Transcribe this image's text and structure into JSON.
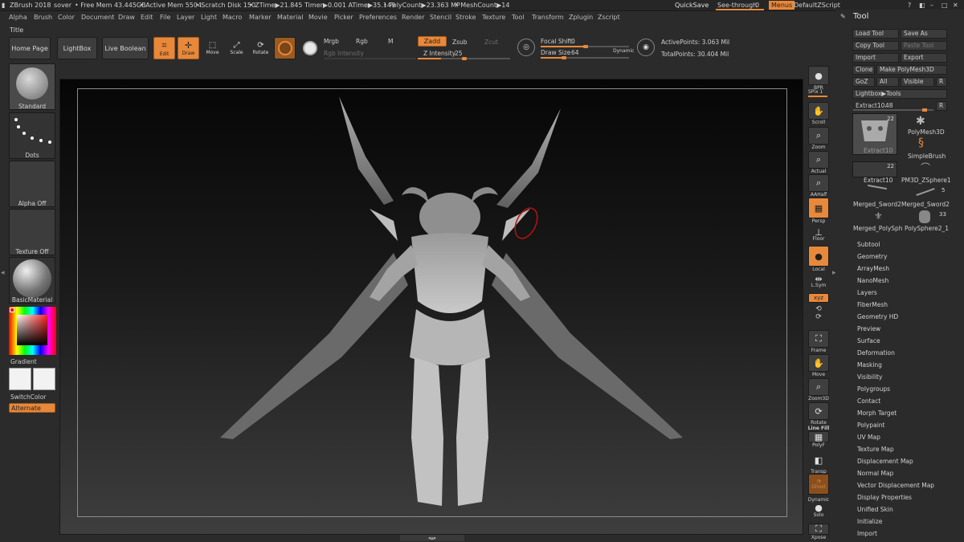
{
  "titlebar": {
    "app": "ZBrush 2018",
    "doc": "sover",
    "free_mem": "• Free Mem 43.445GB",
    "active_mem": "• Active Mem 5504",
    "scratch": "• Scratch Disk 150",
    "ztime": "• ZTime▶21.845 Timer▶0.001 ATime▶35.149",
    "polycount": "• PolyCount▶23.363 MP",
    "meshcount": "• MeshCount▶14",
    "quicksave": "QuickSave",
    "see_through": "See-through",
    "see_through_value": "0",
    "menus": "Menus",
    "script": "DefaultZScript"
  },
  "menubar": {
    "items": [
      "Alpha",
      "Brush",
      "Color",
      "Document",
      "Draw",
      "Edit",
      "File",
      "Layer",
      "Light",
      "Macro",
      "Marker",
      "Material",
      "Movie",
      "Picker",
      "Preferences",
      "Render",
      "Stencil",
      "Stroke",
      "Texture",
      "Tool",
      "Transform",
      "Zplugin",
      "Zscript"
    ]
  },
  "title_label": "Title",
  "toolbar": {
    "home_page": "Home Page",
    "lightbox": "LightBox",
    "live_boolean": "Live Boolean",
    "edit": "Edit",
    "draw": "Draw",
    "move": "Move",
    "scale": "Scale",
    "rotate": "Rotate",
    "mrgb": "Mrgb",
    "rgb": "Rgb",
    "m": "M",
    "zadd": "Zadd",
    "zsub": "Zsub",
    "zcut": "Zcut",
    "rgb_intensity": "Rgb Intensity",
    "z_intensity_label": "Z Intensity",
    "z_intensity": "25",
    "focal_shift_label": "Focal Shift",
    "focal_shift": "0",
    "draw_size_label": "Draw Size",
    "draw_size": "64",
    "dynamic": "Dynamic",
    "active_points": "ActivePoints: 3.063 Mil",
    "total_points": "TotalPoints: 30.404 Mil"
  },
  "left_shelf": {
    "brush": "Standard",
    "stroke": "Dots",
    "alpha": "Alpha Off",
    "texture": "Texture Off",
    "material": "BasicMaterial",
    "gradient": "Gradient",
    "switch_color": "SwitchColor",
    "alternate": "Alternate"
  },
  "right_shelf": {
    "bpr": "BPR",
    "spix_label": "SPix",
    "spix": "1",
    "scroll": "Scroll",
    "zoom": "Zoom",
    "actual": "Actual",
    "aahalf": "AAHalf",
    "persp": "Persp",
    "floor": "Floor",
    "local": "Local",
    "lsym": "L.Sym",
    "xyz": "xyz",
    "frame": "Frame",
    "move": "Move",
    "zoom3d": "Zoom3D",
    "rotate": "Rotate",
    "linefill": "Line Fill",
    "polyf": "PolyF",
    "transp": "Transp",
    "ghost": "Ghost",
    "dynamic": "Dynamic",
    "solo": "Solo",
    "xpose": "Xpose"
  },
  "tool_panel": {
    "header": "Tool",
    "load_tool": "Load Tool",
    "save_as": "Save As",
    "copy_tool": "Copy Tool",
    "paste_tool": "Paste Tool",
    "import": "Import",
    "export": "Export",
    "clone": "Clone",
    "make_polymesh": "Make PolyMesh3D",
    "goz": "GoZ",
    "all": "All",
    "visible": "Visible",
    "r": "R",
    "lightbox_tools": "Lightbox▶Tools",
    "current_tool_label": "Extract10.",
    "current_tool_value": "48",
    "thumbs": [
      {
        "name": "Extract10",
        "count": "22"
      },
      {
        "name": "PolyMesh3D",
        "count": ""
      },
      {
        "name": "SimpleBrush",
        "count": ""
      },
      {
        "name": "Extract10",
        "count": "22"
      },
      {
        "name": "PM3D_ZSphere1",
        "count": ""
      },
      {
        "name": "Merged_Sword2",
        "count": ""
      },
      {
        "name": "Merged_Sword2",
        "count": "5"
      },
      {
        "name": "Merged_PolySph",
        "count": ""
      },
      {
        "name": "PolySphere2_1",
        "count": "33"
      }
    ],
    "subpalettes": [
      "Subtool",
      "Geometry",
      "ArrayMesh",
      "NanoMesh",
      "Layers",
      "FiberMesh",
      "Geometry HD",
      "Preview",
      "Surface",
      "Deformation",
      "Masking",
      "Visibility",
      "Polygroups",
      "Contact",
      "Morph Target",
      "Polypaint",
      "UV Map",
      "Texture Map",
      "Displacement Map",
      "Normal Map",
      "Vector Displacement Map",
      "Display Properties",
      "Unified Skin",
      "Initialize",
      "Import"
    ]
  },
  "colors": {
    "accent": "#e8883a",
    "panel": "#2b2b2b",
    "button": "#3d3d3d"
  }
}
